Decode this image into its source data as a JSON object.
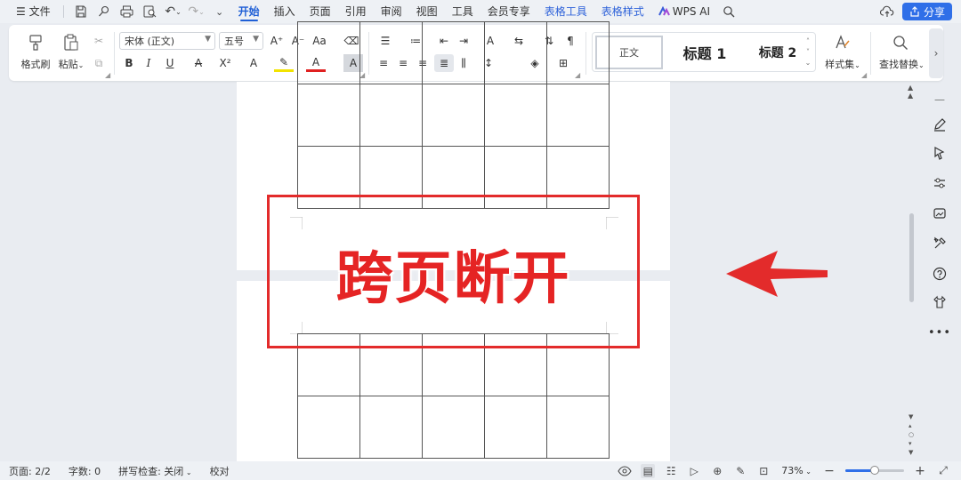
{
  "menu": {
    "file": "文件",
    "tabs": [
      "开始",
      "插入",
      "页面",
      "引用",
      "审阅",
      "视图",
      "工具",
      "会员专享",
      "表格工具",
      "表格样式"
    ],
    "wps_ai": "WPS AI",
    "share": "分享"
  },
  "ribbon": {
    "format_painter": "格式刷",
    "paste": "粘贴",
    "font_name": "宋体 (正文)",
    "font_size": "五号",
    "styles": {
      "normal": "正文",
      "h1": "标题  1",
      "h2": "标题  2"
    },
    "style_set": "样式集",
    "find_replace": "查找替换"
  },
  "callout": {
    "text": "跨页断开",
    "color": "#e52424"
  },
  "status": {
    "page": "页面: 2/2",
    "words": "字数: 0",
    "spell": "拼写检查: 关闭",
    "proof": "校对",
    "zoom": "73%",
    "zoom_level": 0.5
  },
  "colors": {
    "accent": "#1f5fd6",
    "annotation": "#e32b2b"
  }
}
